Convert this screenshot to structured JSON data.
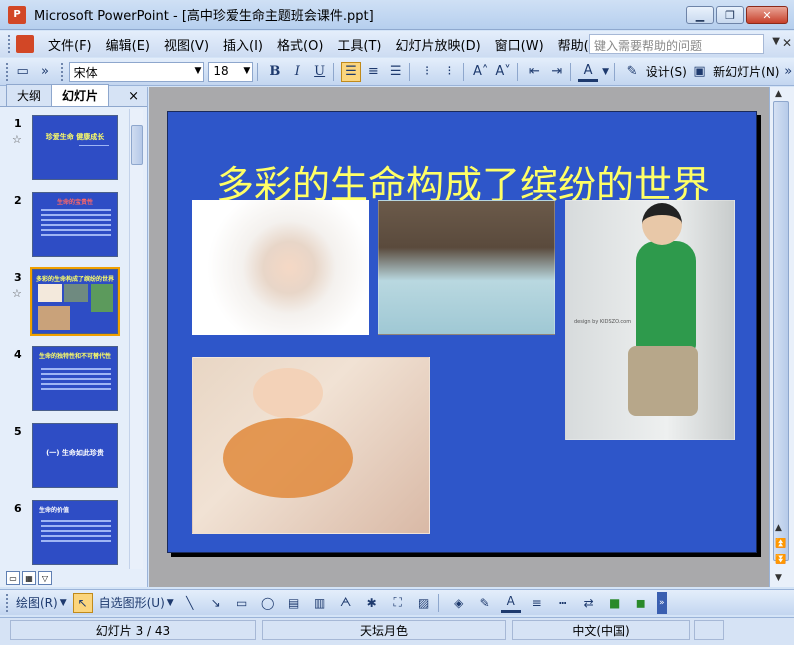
{
  "window": {
    "title": "Microsoft PowerPoint - [高中珍爱生命主题班会课件.ppt]",
    "app_icon": "ppt-icon"
  },
  "menubar": {
    "items": [
      "文件(F)",
      "编辑(E)",
      "视图(V)",
      "插入(I)",
      "格式(O)",
      "工具(T)",
      "幻灯片放映(D)",
      "窗口(W)",
      "帮助(H)"
    ],
    "help_placeholder": "键入需要帮助的问题"
  },
  "toolbar": {
    "font": "宋体",
    "size": "18",
    "bold": "B",
    "italic": "I",
    "underline": "U",
    "design_label": "设计(S)",
    "new_slide_label": "新幻灯片(N)"
  },
  "panel": {
    "tab_outline": "大纲",
    "tab_slides": "幻灯片",
    "close": "×",
    "thumbnails": [
      {
        "num": "1",
        "title": "珍爱生命  健康成长",
        "has_star": true
      },
      {
        "num": "2",
        "title": "生命的宝贵性",
        "has_star": false
      },
      {
        "num": "3",
        "title": "多彩的生命构成了缤纷的世界",
        "has_star": true
      },
      {
        "num": "4",
        "title": "生命的独特性和不可替代性",
        "has_star": false
      },
      {
        "num": "5",
        "title": "(一) 生命如此珍贵",
        "has_star": false
      },
      {
        "num": "6",
        "title": "生命的价值",
        "has_star": false
      }
    ]
  },
  "slide": {
    "title": "多彩的生命构成了缤纷的世界",
    "photo_caption": "design by KIDSZO.com"
  },
  "drawbar": {
    "draw_label": "绘图(R)",
    "autoshapes_label": "自选图形(U)"
  },
  "status": {
    "slide_info": "幻灯片 3 / 43",
    "template": "天坛月色",
    "language": "中文(中国)"
  }
}
